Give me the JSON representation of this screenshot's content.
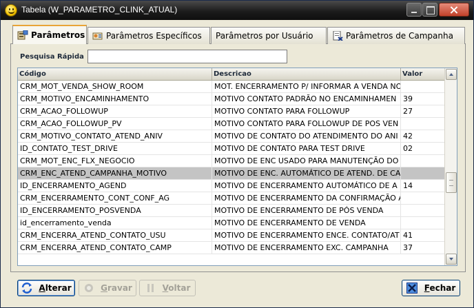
{
  "window": {
    "title": "Tabela (W_PARAMETRO_CLINK_ATUAL)",
    "icon": "smiley-icon"
  },
  "tabs": [
    {
      "label": "Parâmetros",
      "icon": "parameters-icon",
      "active": true
    },
    {
      "label": "Parâmetros Específicos",
      "icon": "specific-parameters-icon",
      "active": false
    },
    {
      "label": "Parâmetros por Usuário",
      "icon": "",
      "active": false
    },
    {
      "label": "Parâmetros de Campanha",
      "icon": "campaign-parameters-icon",
      "active": false
    }
  ],
  "search": {
    "label": "Pesquisa Rápida",
    "value": ""
  },
  "grid": {
    "columns": [
      "Código",
      "Descricao",
      "Valor"
    ],
    "rows": [
      {
        "codigo": "CRM_MOT_VENDA_SHOW_ROOM",
        "descricao": "MOT. ENCERRAMENTO P/ INFORMAR A VENDA NO",
        "valor": ""
      },
      {
        "codigo": "CRM_MOTIVO_ENCAMINHAMENTO",
        "descricao": "MOTIVO CONTATO PADRÃO NO ENCAMINHAMEN",
        "valor": "39"
      },
      {
        "codigo": "CRM_ACAO_FOLLOWUP",
        "descricao": "MOTIVO CONTATO PARA FOLLOWUP",
        "valor": "27"
      },
      {
        "codigo": "CRM_ACAO_FOLLOWUP_PV",
        "descricao": "MOTIVO CONTATO PARA FOLLOWUP DE POS VEN",
        "valor": ""
      },
      {
        "codigo": "CRM_MOTIVO_CONTATO_ATEND_ANIV",
        "descricao": "MOTIVO DE CONTATO DO ATENDIMENTO DO ANI",
        "valor": "42"
      },
      {
        "codigo": "ID_CONTATO_TEST_DRIVE",
        "descricao": "MOTIVO DE CONTATO PARA TEST DRIVE",
        "valor": "02"
      },
      {
        "codigo": "CRM_MOT_ENC_FLX_NEGOCIO",
        "descricao": "MOTIVO DE ENC USADO PARA MANUTENÇÃO DO",
        "valor": ""
      },
      {
        "codigo": "CRM_ENC_ATEND_CAMPANHA_MOTIVO",
        "descricao": "MOTIVO DE ENC. AUTOMÁTICO DE ATEND. DE CA",
        "valor": "",
        "selected": true
      },
      {
        "codigo": "ID_ENCERRAMENTO_AGEND",
        "descricao": "MOTIVO DE ENCERRAMENTO AUTOMÁTICO DE A",
        "valor": "14"
      },
      {
        "codigo": "CRM_ENCERRAMENTO_CONT_CONF_AG",
        "descricao": "MOTIVO DE ENCERRAMENTO DA CONFIRMAÇÃO A",
        "valor": ""
      },
      {
        "codigo": "ID_ENCERRAMENTO_POSVENDA",
        "descricao": "MOTIVO DE ENCERRAMENTO DE PÓS VENDA",
        "valor": ""
      },
      {
        "codigo": "id_encerramento_venda",
        "descricao": "MOTIVO DE ENCERRAMENTO DE VENDA",
        "valor": ""
      },
      {
        "codigo": "CRM_ENCERRA_ATEND_CONTATO_USU",
        "descricao": "MOTIVO DE ENCERRAMENTO ENCE. CONTATO/AT",
        "valor": "41"
      },
      {
        "codigo": "CRM_ENCERRA_ATEND_CONTATO_CAMP",
        "descricao": "MOTIVO DE ENCERRAMENTO EXC. CAMPANHA",
        "valor": "37"
      }
    ]
  },
  "buttons": {
    "alterar": {
      "first": "A",
      "rest": "lterar",
      "icon": "refresh-icon"
    },
    "gravar": {
      "first": "G",
      "rest": "ravar",
      "icon": "save-icon"
    },
    "voltar": {
      "first": "V",
      "rest": "oltar",
      "icon": "undo-icon"
    },
    "fechar": {
      "first": "F",
      "rest": "echar",
      "icon": "close-icon"
    }
  }
}
